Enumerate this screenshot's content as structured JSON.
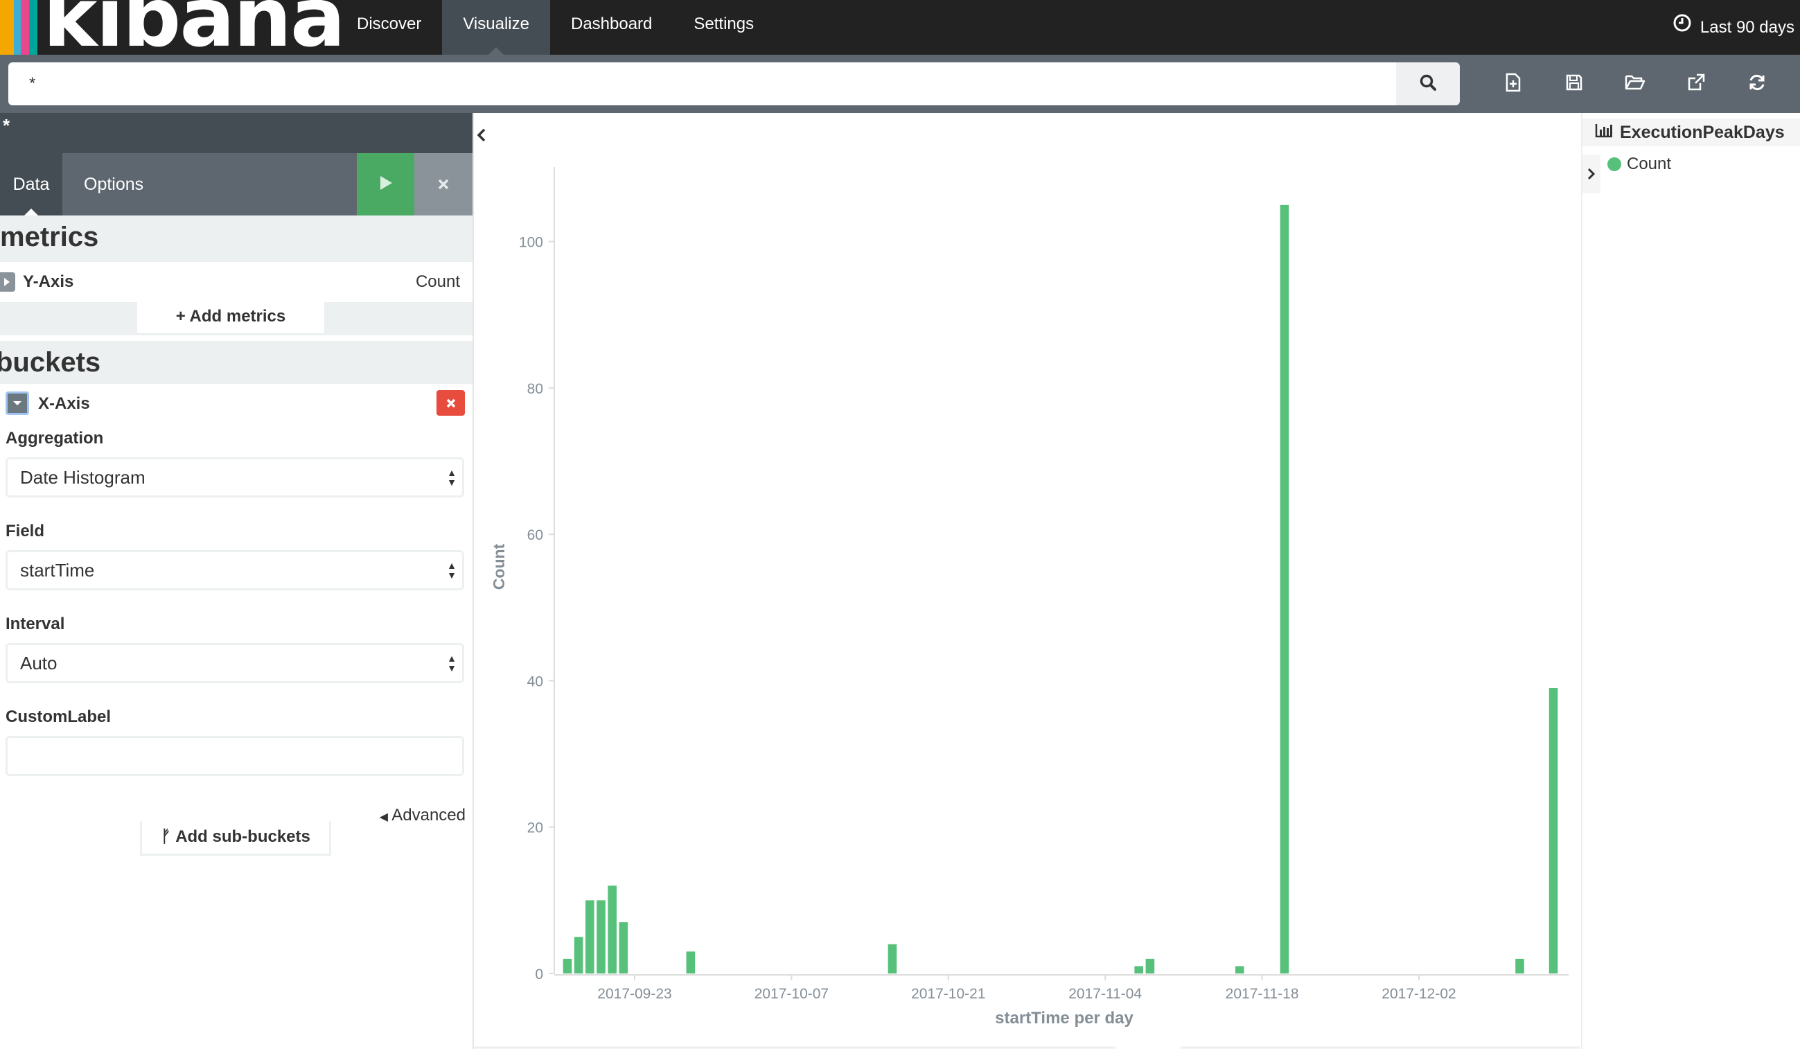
{
  "brand": {
    "logo_text": "kibana",
    "stripe_colors": [
      "#f5a700",
      "#e8488b",
      "#3caed2",
      "#00a69b"
    ]
  },
  "nav": {
    "tabs": [
      {
        "label": "Discover",
        "active": false
      },
      {
        "label": "Visualize",
        "active": true
      },
      {
        "label": "Dashboard",
        "active": false
      },
      {
        "label": "Settings",
        "active": false
      }
    ],
    "timepicker_label": "Last 90 days"
  },
  "search": {
    "query": "*"
  },
  "toolbar": {
    "icons": [
      "new-visualization-icon",
      "save-icon",
      "open-icon",
      "share-icon",
      "refresh-icon"
    ]
  },
  "sidebar": {
    "title": "*",
    "tabs": {
      "data": "Data",
      "options": "Options"
    },
    "metrics": {
      "heading": "metrics",
      "agg": {
        "label": "Y-Axis",
        "value": "Count"
      },
      "add_label": "Add metrics"
    },
    "buckets": {
      "heading": "buckets",
      "agg": {
        "label": "X-Axis"
      },
      "aggregation": {
        "label": "Aggregation",
        "value": "Date Histogram"
      },
      "field": {
        "label": "Field",
        "value": "startTime"
      },
      "interval": {
        "label": "Interval",
        "value": "Auto"
      },
      "custom_label": {
        "label": "CustomLabel",
        "value": ""
      },
      "advanced_label": "Advanced",
      "add_label": "Add sub-buckets"
    }
  },
  "legend": {
    "title": "ExecutionPeakDays",
    "items": [
      {
        "label": "Count",
        "color": "#57c17b"
      }
    ]
  },
  "chart_data": {
    "type": "bar",
    "title": "",
    "xlabel": "startTime per day",
    "ylabel": "Count",
    "ylim": [
      0,
      110
    ],
    "yticks": [
      0,
      20,
      40,
      60,
      80,
      100
    ],
    "x_ticks": [
      "2017-09-23",
      "2017-10-07",
      "2017-10-21",
      "2017-11-04",
      "2017-11-18",
      "2017-12-02"
    ],
    "x_range": [
      "2017-09-16",
      "2017-12-15"
    ],
    "bar_color": "#57c17b",
    "series": [
      {
        "name": "Count",
        "points": [
          {
            "date": "2017-09-17",
            "value": 2
          },
          {
            "date": "2017-09-18",
            "value": 5
          },
          {
            "date": "2017-09-19",
            "value": 10
          },
          {
            "date": "2017-09-20",
            "value": 10
          },
          {
            "date": "2017-09-21",
            "value": 12
          },
          {
            "date": "2017-09-22",
            "value": 7
          },
          {
            "date": "2017-09-28",
            "value": 3
          },
          {
            "date": "2017-10-16",
            "value": 4
          },
          {
            "date": "2017-11-07",
            "value": 1
          },
          {
            "date": "2017-11-08",
            "value": 2
          },
          {
            "date": "2017-11-16",
            "value": 1
          },
          {
            "date": "2017-11-20",
            "value": 105
          },
          {
            "date": "2017-12-11",
            "value": 2
          },
          {
            "date": "2017-12-14",
            "value": 39
          }
        ]
      }
    ]
  }
}
